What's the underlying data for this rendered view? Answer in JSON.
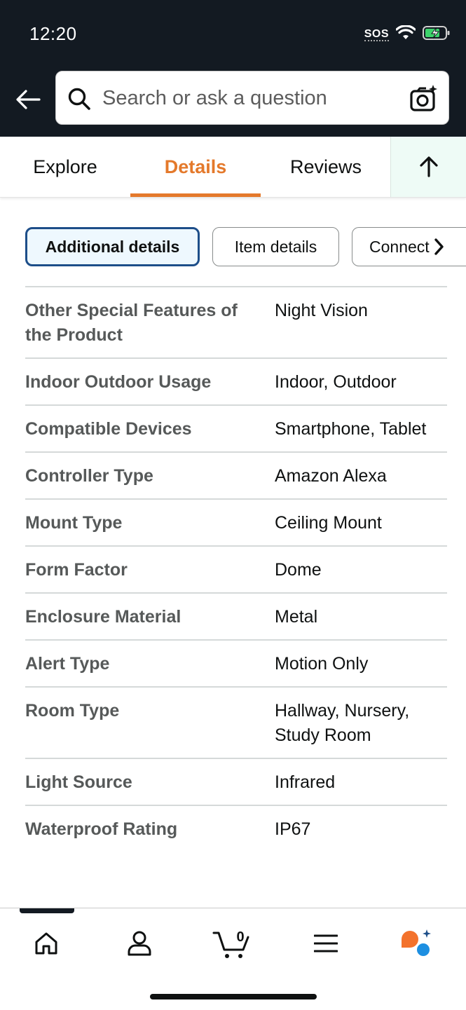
{
  "status_bar": {
    "time": "12:20",
    "sos": "SOS"
  },
  "search": {
    "placeholder": "Search or ask a question"
  },
  "tabs": [
    {
      "label": "Explore",
      "active": false
    },
    {
      "label": "Details",
      "active": true
    },
    {
      "label": "Reviews",
      "active": false
    }
  ],
  "chips": [
    {
      "label": "Additional details",
      "selected": true
    },
    {
      "label": "Item details",
      "selected": false
    },
    {
      "label": "Connect",
      "selected": false
    }
  ],
  "details": [
    {
      "key": "Other Special Features of the Product",
      "value": "Night Vision"
    },
    {
      "key": "Indoor Outdoor Usage",
      "value": "Indoor, Outdoor"
    },
    {
      "key": "Compatible Devices",
      "value": "Smartphone, Tablet"
    },
    {
      "key": "Controller Type",
      "value": "Amazon Alexa"
    },
    {
      "key": "Mount Type",
      "value": "Ceiling Mount"
    },
    {
      "key": "Form Factor",
      "value": "Dome"
    },
    {
      "key": "Enclosure Material",
      "value": "Metal"
    },
    {
      "key": "Alert Type",
      "value": "Motion Only"
    },
    {
      "key": "Room Type",
      "value": "Hallway, Nursery, Study Room"
    },
    {
      "key": "Light Source",
      "value": "Infrared"
    },
    {
      "key": "Waterproof Rating",
      "value": "IP67"
    }
  ],
  "bottom_nav": {
    "items": [
      "home-icon",
      "account-icon",
      "cart-icon",
      "menu-icon",
      "rufus-ai-icon"
    ],
    "cart_count": "0"
  },
  "colors": {
    "header_bg": "#131a22",
    "accent_orange": "#e4792b",
    "chip_selected_border": "#1d4e89"
  }
}
